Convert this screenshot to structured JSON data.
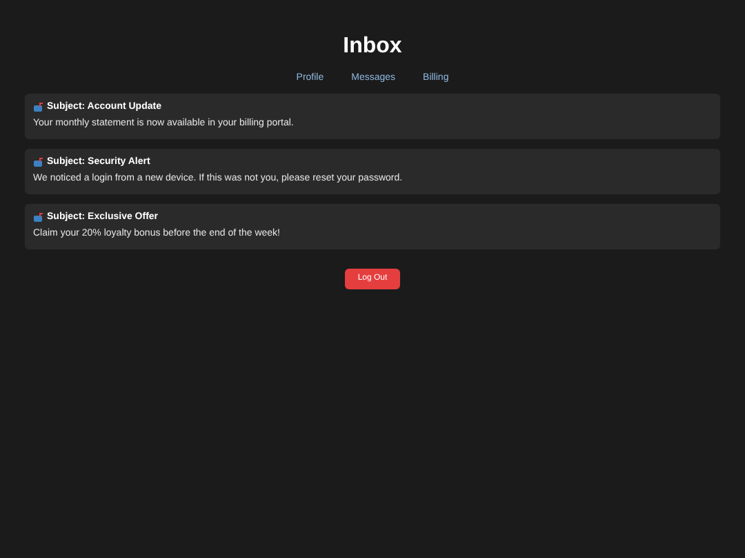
{
  "title": "Inbox",
  "nav": [
    "Profile",
    "Messages",
    "Billing"
  ],
  "messages": [
    {
      "subject": "Subject: Account Update",
      "body": "Your monthly statement is now available in your billing portal."
    },
    {
      "subject": "Subject: Security Alert",
      "body": "We noticed a login from a new device. If this was not you, please reset your password."
    },
    {
      "subject": "Subject: Exclusive Offer",
      "body": "Claim your 20% loyalty bonus before the end of the week!"
    }
  ],
  "logout": "Log Out"
}
